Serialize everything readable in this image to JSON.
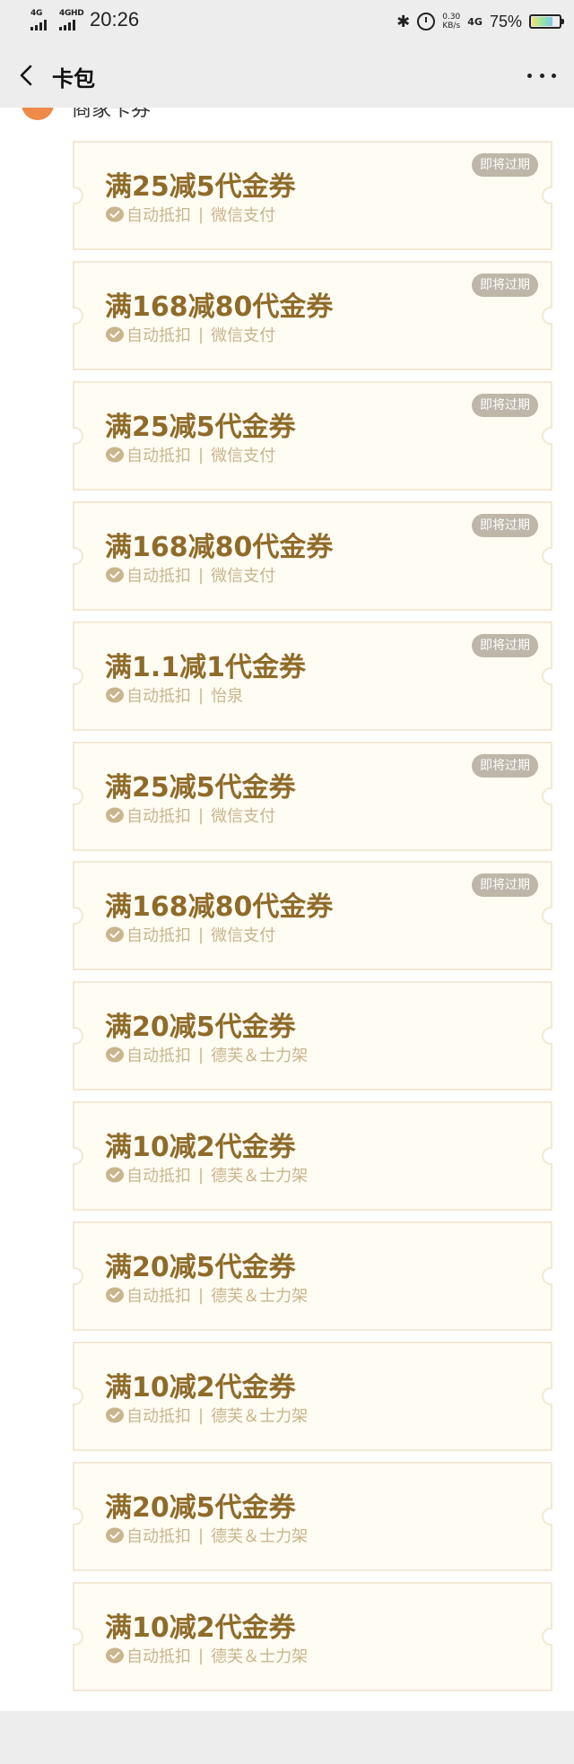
{
  "status_bar": {
    "network_1": "4G",
    "network_2": "4GHD",
    "time": "20:26",
    "bluetooth_icon": "bluetooth-icon",
    "alarm_icon": "alarm-icon",
    "speed_value": "0.30",
    "speed_unit": "KB/s",
    "network_3": "4G",
    "battery_percent": "75%",
    "battery_level": 0.75
  },
  "nav": {
    "back_icon": "chevron-left-icon",
    "title": "卡包",
    "more_icon": "more-dots-icon"
  },
  "section": {
    "name": "商家卡券"
  },
  "coupons": [
    {
      "title": "满25减5代金券",
      "tag": "自动抵扣",
      "merchant": "微信支付",
      "badge": "即将过期"
    },
    {
      "title": "满168减80代金券",
      "tag": "自动抵扣",
      "merchant": "微信支付",
      "badge": "即将过期"
    },
    {
      "title": "满25减5代金券",
      "tag": "自动抵扣",
      "merchant": "微信支付",
      "badge": "即将过期"
    },
    {
      "title": "满168减80代金券",
      "tag": "自动抵扣",
      "merchant": "微信支付",
      "badge": "即将过期"
    },
    {
      "title": "满1.1减1代金券",
      "tag": "自动抵扣",
      "merchant": "怡泉",
      "badge": "即将过期"
    },
    {
      "title": "满25减5代金券",
      "tag": "自动抵扣",
      "merchant": "微信支付",
      "badge": "即将过期"
    },
    {
      "title": "满168减80代金券",
      "tag": "自动抵扣",
      "merchant": "微信支付",
      "badge": "即将过期"
    },
    {
      "title": "满20减5代金券",
      "tag": "自动抵扣",
      "merchant": "德芙＆士力架",
      "badge": ""
    },
    {
      "title": "满10减2代金券",
      "tag": "自动抵扣",
      "merchant": "德芙＆士力架",
      "badge": ""
    },
    {
      "title": "满20减5代金券",
      "tag": "自动抵扣",
      "merchant": "德芙＆士力架",
      "badge": ""
    },
    {
      "title": "满10减2代金券",
      "tag": "自动抵扣",
      "merchant": "德芙＆士力架",
      "badge": ""
    },
    {
      "title": "满20减5代金券",
      "tag": "自动抵扣",
      "merchant": "德芙＆士力架",
      "badge": ""
    },
    {
      "title": "满10减2代金券",
      "tag": "自动抵扣",
      "merchant": "德芙＆士力架",
      "badge": ""
    }
  ],
  "colors": {
    "coupon_title": "#8f6b2a",
    "coupon_sub": "#c9b58e",
    "coupon_bg": "#fffcf3",
    "coupon_border": "#f2e9d4",
    "badge_bg": "#bdb6a9",
    "header_bg": "#ededed"
  }
}
